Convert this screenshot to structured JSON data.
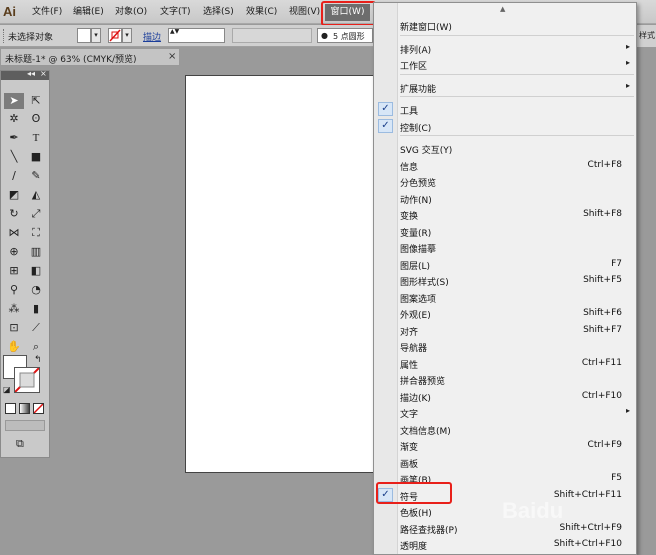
{
  "app": {
    "logo": "Ai"
  },
  "menubar": {
    "items": [
      "文件(F)",
      "编辑(E)",
      "对象(O)",
      "文字(T)",
      "选择(S)",
      "效果(C)",
      "视图(V)"
    ],
    "active": "窗口(W)"
  },
  "control": {
    "selection_label": "未选择对象",
    "stroke_label": "描边",
    "stroke_spinner": "▲▼",
    "brush_label": "5 点圆形",
    "overflow_label": "样式"
  },
  "document": {
    "tab_label": "未标题-1* @ 63% (CMYK/预览)",
    "close": "×"
  },
  "tools": {
    "collapse": "◂◂",
    "close": "×"
  },
  "dropdown": {
    "scroll_up": "▲",
    "items": [
      {
        "label": "新建窗口(W)",
        "shortcut": "",
        "checked": false,
        "sub": false
      },
      {
        "label": "排列(A)",
        "shortcut": "",
        "checked": false,
        "sub": true
      },
      {
        "label": "工作区",
        "shortcut": "",
        "checked": false,
        "sub": true
      },
      {
        "label": "扩展功能",
        "shortcut": "",
        "checked": false,
        "sub": true
      },
      {
        "label": "工具",
        "shortcut": "",
        "checked": true,
        "sub": false
      },
      {
        "label": "控制(C)",
        "shortcut": "",
        "checked": true,
        "sub": false
      },
      {
        "label": "SVG 交互(Y)",
        "shortcut": "",
        "checked": false,
        "sub": false
      },
      {
        "label": "信息",
        "shortcut": "Ctrl+F8",
        "checked": false,
        "sub": false
      },
      {
        "label": "分色预览",
        "shortcut": "",
        "checked": false,
        "sub": false
      },
      {
        "label": "动作(N)",
        "shortcut": "",
        "checked": false,
        "sub": false
      },
      {
        "label": "变换",
        "shortcut": "Shift+F8",
        "checked": false,
        "sub": false
      },
      {
        "label": "变量(R)",
        "shortcut": "",
        "checked": false,
        "sub": false
      },
      {
        "label": "图像描摹",
        "shortcut": "",
        "checked": false,
        "sub": false
      },
      {
        "label": "图层(L)",
        "shortcut": "F7",
        "checked": false,
        "sub": false
      },
      {
        "label": "图形样式(S)",
        "shortcut": "Shift+F5",
        "checked": false,
        "sub": false
      },
      {
        "label": "图案选项",
        "shortcut": "",
        "checked": false,
        "sub": false
      },
      {
        "label": "外观(E)",
        "shortcut": "Shift+F6",
        "checked": false,
        "sub": false
      },
      {
        "label": "对齐",
        "shortcut": "Shift+F7",
        "checked": false,
        "sub": false
      },
      {
        "label": "导航器",
        "shortcut": "",
        "checked": false,
        "sub": false
      },
      {
        "label": "属性",
        "shortcut": "Ctrl+F11",
        "checked": false,
        "sub": false
      },
      {
        "label": "拼合器预览",
        "shortcut": "",
        "checked": false,
        "sub": false
      },
      {
        "label": "描边(K)",
        "shortcut": "Ctrl+F10",
        "checked": false,
        "sub": false
      },
      {
        "label": "文字",
        "shortcut": "",
        "checked": false,
        "sub": true
      },
      {
        "label": "文档信息(M)",
        "shortcut": "",
        "checked": false,
        "sub": false
      },
      {
        "label": "渐变",
        "shortcut": "Ctrl+F9",
        "checked": false,
        "sub": false
      },
      {
        "label": "画板",
        "shortcut": "",
        "checked": false,
        "sub": false
      },
      {
        "label": "画笔(B)",
        "shortcut": "F5",
        "checked": false,
        "sub": false
      },
      {
        "label": "符号",
        "shortcut": "Shift+Ctrl+F11",
        "checked": true,
        "sub": false
      },
      {
        "label": "色板(H)",
        "shortcut": "",
        "checked": false,
        "sub": false
      },
      {
        "label": "路径查找器(P)",
        "shortcut": "Shift+Ctrl+F9",
        "checked": false,
        "sub": false
      },
      {
        "label": "透明度",
        "shortcut": "Shift+Ctrl+F10",
        "checked": false,
        "sub": false
      }
    ]
  },
  "colors": {
    "highlight": "#e8201a",
    "active_menu": "#6d6d6d"
  }
}
